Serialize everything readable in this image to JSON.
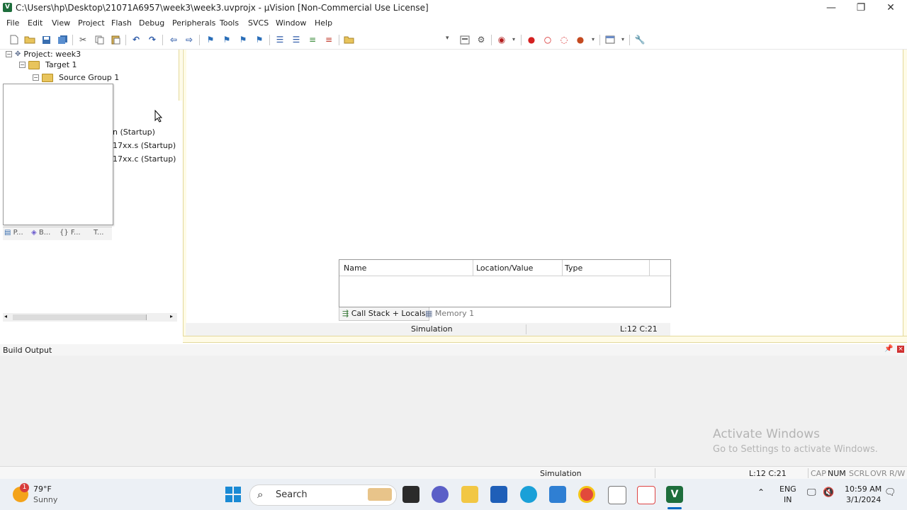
{
  "window": {
    "title": "C:\\Users\\hp\\Desktop\\21071A6957\\week3\\week3.uvprojx - µVision  [Non-Commercial Use License]",
    "minimize": "—",
    "maximize": "❐",
    "close": "✕"
  },
  "menu": [
    "File",
    "Edit",
    "View",
    "Project",
    "Flash",
    "Debug",
    "Peripherals",
    "Tools",
    "SVCS",
    "Window",
    "Help"
  ],
  "project_tree": {
    "root": "Project: week3",
    "target": "Target 1",
    "group": "Source Group 1",
    "files": [
      "n (Startup)",
      "17xx.s (Startup)",
      "17xx.c (Startup)"
    ]
  },
  "panel_tabs": [
    "P...",
    "B...",
    "{} F...",
    "T..."
  ],
  "watch": {
    "columns": [
      "Name",
      "Location/Value",
      "Type"
    ],
    "tabs": [
      "Call Stack + Locals",
      "Memory 1"
    ]
  },
  "upper_status": {
    "mode": "Simulation",
    "cursor": "L:12 C:21"
  },
  "build_output": {
    "title": "Build Output"
  },
  "activation": {
    "line1": "Activate Windows",
    "line2": "Go to Settings to activate Windows."
  },
  "status_bar": {
    "mode": "Simulation",
    "cursor": "L:12 C:21",
    "indicators": [
      "CAP",
      "NUM",
      "SCRL",
      "OVR",
      "R/W"
    ]
  },
  "taskbar": {
    "weather_temp": "79°F",
    "weather_desc": "Sunny",
    "weather_badge": "1",
    "search": "Search",
    "lang_line1": "ENG",
    "lang_line2": "IN",
    "time": "10:59 AM",
    "date": "3/1/2024"
  },
  "colors": {
    "accent": "#0067c0",
    "folder": "#e8c45c",
    "uvision_green": "#1e6e3c"
  }
}
